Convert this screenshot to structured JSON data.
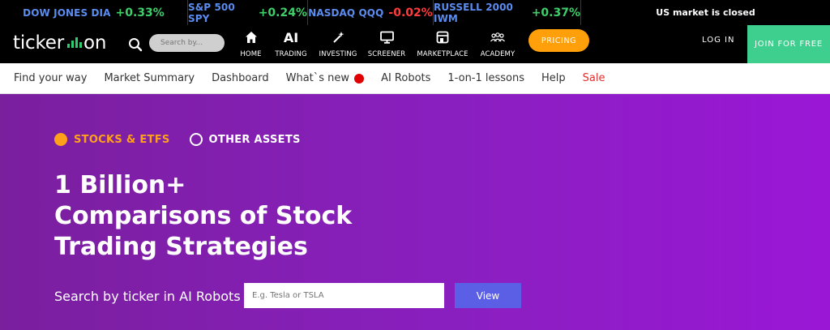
{
  "tickers": [
    {
      "name": "DOW JONES DIA",
      "change": "+0.33%",
      "direction": "up"
    },
    {
      "name": "S&P 500 SPY",
      "change": "+0.24%",
      "direction": "up"
    },
    {
      "name": "NASDAQ QQQ",
      "change": "-0.02%",
      "direction": "down"
    },
    {
      "name": "RUSSELL 2000 IWM",
      "change": "+0.37%",
      "direction": "up"
    }
  ],
  "market_status": "US market is closed",
  "header": {
    "logo_left": "ticker",
    "logo_right": "on",
    "search_placeholder": "Search by...",
    "nav": [
      {
        "label": "HOME",
        "icon": "home-icon"
      },
      {
        "label": "TRADING",
        "icon": "ai-icon"
      },
      {
        "label": "INVESTING",
        "icon": "wand-icon"
      },
      {
        "label": "SCREENER",
        "icon": "monitor-icon"
      },
      {
        "label": "MARKETPLACE",
        "icon": "store-icon"
      },
      {
        "label": "ACADEMY",
        "icon": "people-icon"
      }
    ],
    "ai_glyph": "AI",
    "pricing": "PRICING",
    "login": "LOG IN",
    "join": "JOIN FOR FREE"
  },
  "subnav": [
    "Find your way",
    "Market Summary",
    "Dashboard",
    "What`s new",
    "AI Robots",
    "1-on-1 lessons",
    "Help",
    "Sale"
  ],
  "hero": {
    "option_active": "STOCKS & ETFS",
    "option_inactive": "OTHER ASSETS",
    "title_lines": [
      "1 Billion+",
      "Comparisons of Stock",
      "Trading Strategies"
    ],
    "search_label": "Search by ticker in AI Robots",
    "search_placeholder": "E.g. Tesla or TSLA",
    "view_button": "View"
  },
  "colors": {
    "accent_orange": "#ff9f0a",
    "join_green": "#3ecf8e",
    "hero_purple": "#8a1fc0",
    "up_green": "#3ecf6b",
    "down_red": "#ff3b3b",
    "view_blue": "#5a5fe6"
  }
}
